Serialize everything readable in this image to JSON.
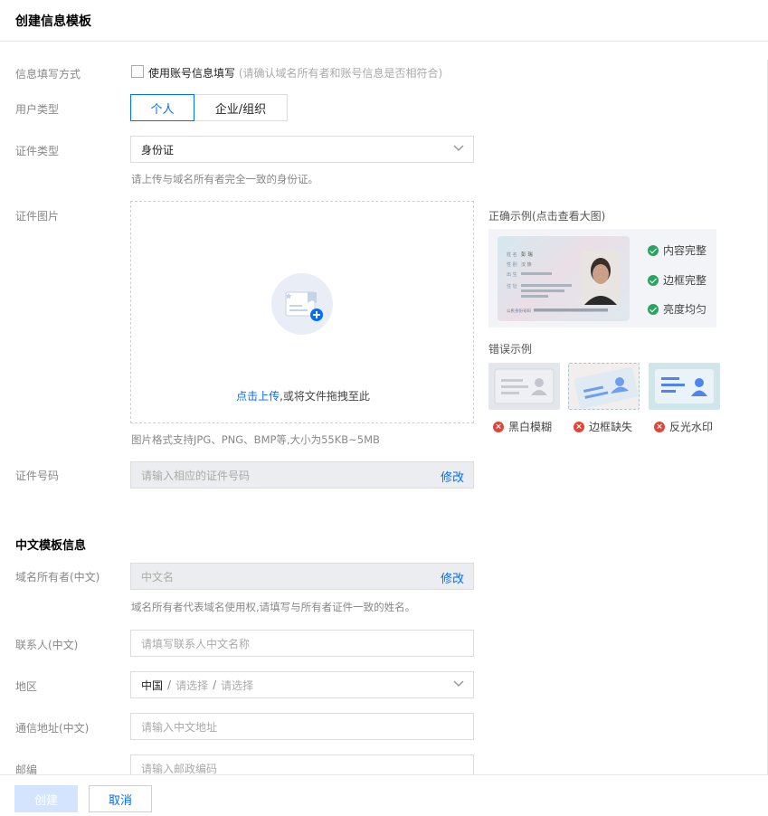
{
  "header": {
    "title": "创建信息模板"
  },
  "form": {
    "fill_method": {
      "label": "信息填写方式",
      "checkbox_label": "使用账号信息填写",
      "checkbox_note": "(请确认域名所有者和账号信息是否相符合)"
    },
    "user_type": {
      "label": "用户类型",
      "options": [
        "个人",
        "企业/组织"
      ],
      "selected": "个人"
    },
    "id_type": {
      "label": "证件类型",
      "value": "身份证",
      "hint": "请上传与域名所有者完全一致的身份证。"
    },
    "id_image": {
      "label": "证件图片",
      "upload_link": "点击上传",
      "upload_text": ",或将文件拖拽至此",
      "hint": "图片格式支持JPG、PNG、BMP等,大小为55KB~5MB"
    },
    "id_number": {
      "label": "证件号码",
      "placeholder": "请输入相应的证件号码",
      "action": "修改"
    }
  },
  "examples": {
    "correct_title": "正确示例(点击查看大图)",
    "correct_items": [
      "内容完整",
      "边框完整",
      "亮度均匀"
    ],
    "wrong_title": "错误示例",
    "wrong_items": [
      "黑白模糊",
      "边框缺失",
      "反光水印"
    ],
    "card": {
      "name_label": "姓 名",
      "name_value": "彭 瑞",
      "gender_label": "性 别",
      "ethnic_value": "汉 族",
      "birth_label": "出 生",
      "address_label": "住 址",
      "id_label": "公民身份号码"
    }
  },
  "chinese_section": {
    "title": "中文模板信息",
    "owner": {
      "label": "域名所有者(中文)",
      "placeholder": "中文名",
      "action": "修改",
      "hint": "域名所有者代表域名使用权,请填写与所有者证件一致的姓名。"
    },
    "contact": {
      "label": "联系人(中文)",
      "placeholder": "请填写联系人中文名称"
    },
    "region": {
      "label": "地区",
      "country": "中国",
      "sep": "/",
      "province_placeholder": "请选择",
      "city_placeholder": "请选择"
    },
    "address": {
      "label": "通信地址(中文)",
      "placeholder": "请输入中文地址"
    },
    "postcode": {
      "label": "邮编",
      "placeholder": "请输入邮政编码"
    }
  },
  "footer": {
    "create_label": "创建",
    "cancel_label": "取消"
  },
  "colors": {
    "accent": "#006eff",
    "success": "#29a264",
    "error": "#e0453a",
    "disabled_button": "#d3e5fe"
  }
}
